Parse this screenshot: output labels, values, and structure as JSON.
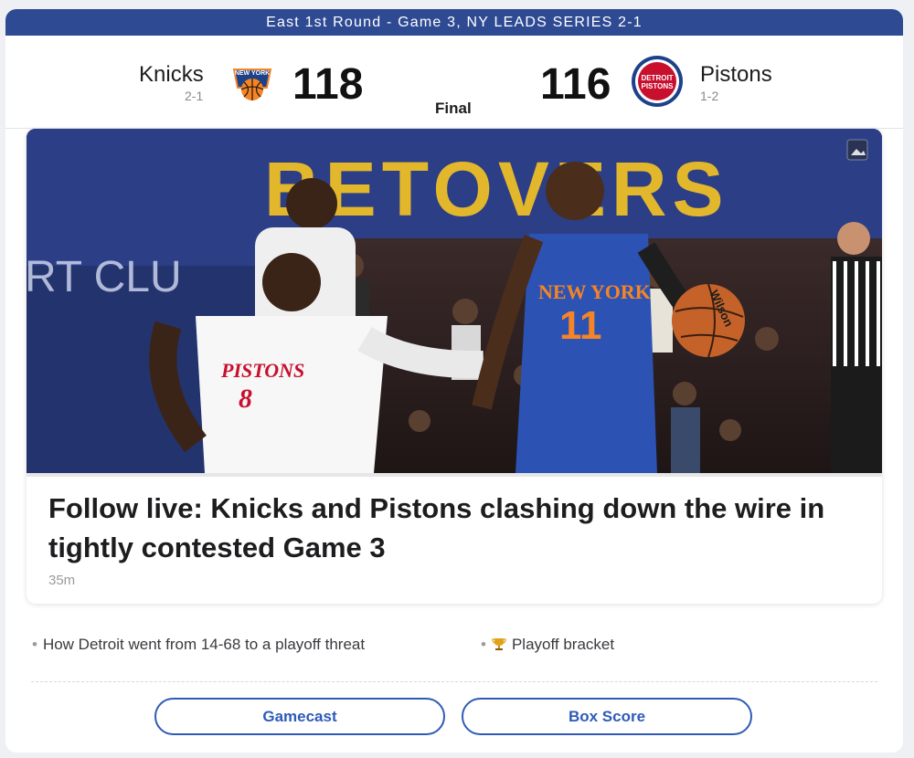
{
  "banner": {
    "text": "East 1st Round - Game 3, NY LEADS SERIES 2-1"
  },
  "home": {
    "name": "Knicks",
    "record": "2-1",
    "score": "118",
    "logo_text": "NEW YORK",
    "logo_name": "knicks-logo",
    "color": "#f58426"
  },
  "away": {
    "name": "Pistons",
    "record": "1-2",
    "score": "116",
    "logo_text_1": "DETROIT",
    "logo_text_2": "PISTONS",
    "logo_name": "pistons-logo",
    "color": "#c8102e"
  },
  "status": "Final",
  "story": {
    "headline": "Follow live: Knicks and Pistons clashing down the wire in tightly contested Game 3",
    "time": "35m",
    "photo": {
      "banner_text": "BETOVERS",
      "wall_text": "RT CLU",
      "pistons_jersey_text": "PISTONS",
      "pistons_number": "8",
      "knicks_jersey_text": "NEW YORK",
      "knicks_number": "11",
      "ball_brand": "Wilson"
    }
  },
  "links": [
    {
      "label": "How Detroit went from 14-68 to a playoff threat"
    },
    {
      "label": "Playoff bracket",
      "icon": "trophy-icon"
    }
  ],
  "buttons": {
    "gamecast": "Gamecast",
    "box_score": "Box Score"
  },
  "colors": {
    "banner": "#2e4a93",
    "accent": "#2f5bb7"
  }
}
